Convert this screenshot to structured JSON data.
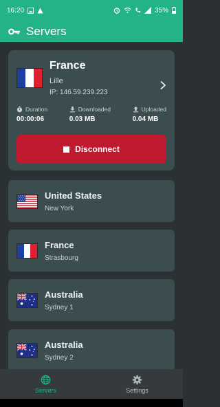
{
  "status_bar": {
    "time": "16:20",
    "battery": "35%"
  },
  "app_bar": {
    "title": "Servers",
    "icon": "key-icon"
  },
  "active_server": {
    "country": "France",
    "city": "Lille",
    "ip": "IP: 146.59.239.223",
    "flag": "france",
    "stats": {
      "duration_label": "Duration",
      "duration_value": "00:00:06",
      "downloaded_label": "Downloaded",
      "downloaded_value": "0.03 MB",
      "uploaded_label": "Uploaded",
      "uploaded_value": "0.04 MB"
    },
    "disconnect_label": "Disconnect"
  },
  "servers": [
    {
      "country": "United States",
      "city": "New York",
      "flag": "usa"
    },
    {
      "country": "France",
      "city": "Strasbourg",
      "flag": "france"
    },
    {
      "country": "Australia",
      "city": "Sydney 1",
      "flag": "australia"
    },
    {
      "country": "Australia",
      "city": "Sydney 2",
      "flag": "australia"
    }
  ],
  "bottom_nav": [
    {
      "label": "Servers",
      "icon": "globe-icon",
      "active": true
    },
    {
      "label": "Settings",
      "icon": "gear-icon",
      "active": false
    }
  ],
  "colors": {
    "accent": "#24b287",
    "card": "#3b4d4e",
    "background": "#2b3033",
    "danger": "#bf1a2f"
  }
}
